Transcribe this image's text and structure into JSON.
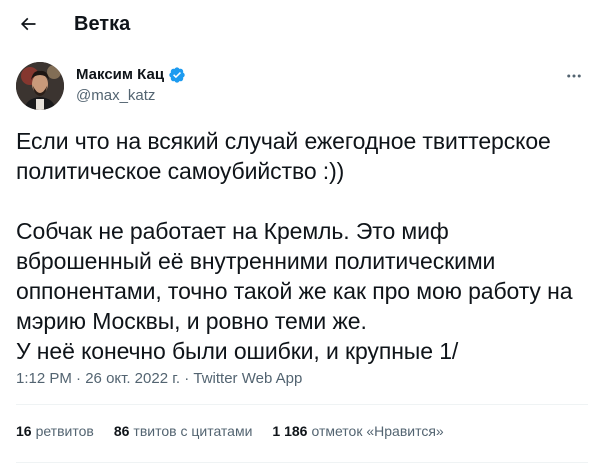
{
  "header": {
    "title": "Ветка",
    "back_icon": "arrow-left-icon"
  },
  "author": {
    "display_name": "Максим Кац",
    "handle": "@max_katz",
    "verified_icon": "verified-badge-icon",
    "verified_color": "#1d9bf0",
    "more_icon": "more-horizontal-icon"
  },
  "tweet": {
    "text": "Если что на всякий случай ежегодное твиттерское политическое самоубийство :))\n\nСобчак не работает на Кремль. Это миф вброшенный её внутренними политическими оппонентами, точно такой же как про мою работу на мэрию Москвы, и ровно теми же.\nУ неё конечно были ошибки, и крупные 1/"
  },
  "meta": {
    "time": "1:12 PM",
    "separator": " · ",
    "date": "26 окт. 2022 г.",
    "source": "Twitter Web App"
  },
  "stats": {
    "retweets_count": "16",
    "retweets_label": "ретвитов",
    "quotes_count": "86",
    "quotes_label": "твитов с цитатами",
    "likes_count": "1 186",
    "likes_label": "отметок «Нравится»"
  },
  "colors": {
    "text": "#0f1419",
    "secondary": "#536471",
    "accent": "#1d9bf0",
    "divider": "#eff3f4"
  }
}
